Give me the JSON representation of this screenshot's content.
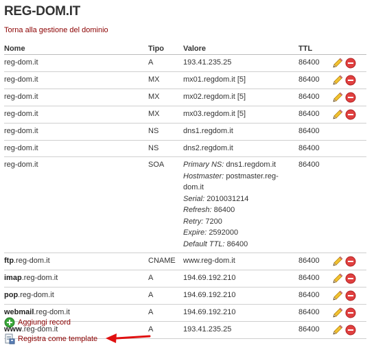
{
  "header": {
    "title": "REG-DOM.IT"
  },
  "back_link": "Torna alla gestione del dominio",
  "table": {
    "columns": {
      "name": "Nome",
      "type": "Tipo",
      "value": "Valore",
      "ttl": "TTL"
    },
    "rows": [
      {
        "prefix": "",
        "name": "reg-dom.it",
        "type": "A",
        "value": "193.41.235.25",
        "ttl": "86400",
        "editable": true
      },
      {
        "prefix": "",
        "name": "reg-dom.it",
        "type": "MX",
        "value": "mx01.regdom.it [5]",
        "ttl": "86400",
        "editable": true
      },
      {
        "prefix": "",
        "name": "reg-dom.it",
        "type": "MX",
        "value": "mx02.regdom.it [5]",
        "ttl": "86400",
        "editable": true
      },
      {
        "prefix": "",
        "name": "reg-dom.it",
        "type": "MX",
        "value": "mx03.regdom.it [5]",
        "ttl": "86400",
        "editable": true
      },
      {
        "prefix": "",
        "name": "reg-dom.it",
        "type": "NS",
        "value": "dns1.regdom.it",
        "ttl": "86400",
        "editable": false
      },
      {
        "prefix": "",
        "name": "reg-dom.it",
        "type": "NS",
        "value": "dns2.regdom.it",
        "ttl": "86400",
        "editable": false
      },
      {
        "prefix": "",
        "name": "reg-dom.it",
        "type": "SOA",
        "ttl": "86400",
        "editable": false,
        "soa": [
          {
            "label": "Primary NS:",
            "value": "dns1.regdom.it"
          },
          {
            "label": "Hostmaster:",
            "value": "postmaster.reg-dom.it"
          },
          {
            "label": "Serial:",
            "value": "2010031214"
          },
          {
            "label": "Refresh:",
            "value": "86400"
          },
          {
            "label": "Retry:",
            "value": "7200"
          },
          {
            "label": "Expire:",
            "value": "2592000"
          },
          {
            "label": "Default TTL:",
            "value": "86400"
          }
        ]
      },
      {
        "prefix": "ftp",
        "name": ".reg-dom.it",
        "type": "CNAME",
        "value": "www.reg-dom.it",
        "ttl": "86400",
        "editable": true
      },
      {
        "prefix": "imap",
        "name": ".reg-dom.it",
        "type": "A",
        "value": "194.69.192.210",
        "ttl": "86400",
        "editable": true
      },
      {
        "prefix": "pop",
        "name": ".reg-dom.it",
        "type": "A",
        "value": "194.69.192.210",
        "ttl": "86400",
        "editable": true
      },
      {
        "prefix": "webmail",
        "name": ".reg-dom.it",
        "type": "A",
        "value": "194.69.192.210",
        "ttl": "86400",
        "editable": true
      },
      {
        "prefix": "www",
        "name": ".reg-dom.it",
        "type": "A",
        "value": "193.41.235.25",
        "ttl": "86400",
        "editable": true
      }
    ]
  },
  "actions": {
    "add_record": "Aggiungi record",
    "save_template": "Registra come template"
  },
  "icons": {
    "edit": "pencil-icon",
    "delete": "delete-icon",
    "add": "add-icon",
    "template": "template-icon",
    "annotation": "red-arrow"
  },
  "colors": {
    "link": "#8b0000",
    "delete_red": "#e04040",
    "add_green": "#3aa63a",
    "arrow_red": "#e01010"
  }
}
